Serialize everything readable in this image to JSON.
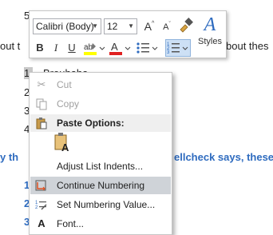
{
  "document": {
    "line0_num": "5",
    "line1_left": "out t",
    "line1_right": "bout thes",
    "list_nums": [
      "1.",
      "2",
      "3",
      "4"
    ],
    "item1_text": "Brouhaha",
    "blue_left": "y th",
    "blue_right": "ellcheck says, these",
    "blue_nums": [
      "1",
      "2",
      "3"
    ]
  },
  "toolbar": {
    "font_name": "Calibri (Body)",
    "font_size": "12",
    "grow_font": "A",
    "shrink_font": "A",
    "bold": "B",
    "italic": "I",
    "underline": "U",
    "styles_label": "Styles",
    "colors": {
      "highlight": "#ffff00",
      "font_color": "#e02020",
      "accent": "#2e6bbf"
    }
  },
  "context_menu": {
    "items": [
      {
        "label": "Cut",
        "icon": "scissors-icon",
        "enabled": false
      },
      {
        "label": "Copy",
        "icon": "copy-icon",
        "enabled": false
      },
      {
        "label": "Paste Options:",
        "icon": "clipboard-icon",
        "header": true
      },
      {
        "label": "Adjust List Indents...",
        "icon": "",
        "enabled": true
      },
      {
        "label": "Continue Numbering",
        "icon": "continue-numbering-icon",
        "enabled": true,
        "hovered": true
      },
      {
        "label": "Set Numbering Value...",
        "icon": "set-numbering-value-icon",
        "enabled": true
      },
      {
        "label": "Font...",
        "icon": "font-icon",
        "enabled": true
      }
    ],
    "paste_option": "keep-text-only-icon"
  }
}
